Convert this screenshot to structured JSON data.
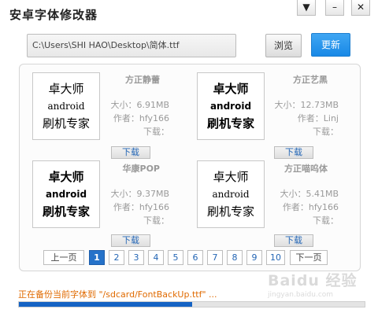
{
  "window": {
    "title": "安卓字体修改器",
    "menu_glyph": "▼",
    "min_glyph": "–",
    "close_glyph": "✕"
  },
  "path_field": {
    "value": "C:\\Users\\SHI HAO\\Desktop\\简体.ttf"
  },
  "buttons": {
    "browse": "浏览",
    "update": "更新"
  },
  "preview_text": {
    "line1": "卓大师",
    "line2": "android",
    "line3": "刷机专家"
  },
  "fonts": [
    {
      "name": "方正静蕾",
      "size": "大小：6.91MB",
      "author": "作者：hfy166",
      "downloads": "下载：",
      "download_label": "下载"
    },
    {
      "name": "方正艺黑",
      "size": "大小：12.73MB",
      "author": "作者：Linj",
      "downloads": "下载：",
      "download_label": "下载"
    },
    {
      "name": "华康POP",
      "size": "大小：9.37MB",
      "author": "作者：hfy166",
      "downloads": "下载：",
      "download_label": "下载"
    },
    {
      "name": "方正喵呜体",
      "size": "大小：5.41MB",
      "author": "作者：hfy166",
      "downloads": "下载：",
      "download_label": "下载"
    }
  ],
  "pagination": {
    "prev": "上一页",
    "next": "下一页",
    "pages": [
      "1",
      "2",
      "3",
      "4",
      "5",
      "6",
      "7",
      "8",
      "9",
      "10"
    ],
    "current": "1"
  },
  "status": {
    "text": "正在备份当前字体到 \"/sdcard/FontBackUp.ttf\" ...",
    "progress": 0.5
  },
  "watermark": {
    "main": "Baidu 经验",
    "sub": "jingyan.baidu.com"
  },
  "colors": {
    "accent": "#1888e6",
    "status": "#e06a00",
    "progress": "#1563c4",
    "active_page": "#2572c9"
  }
}
